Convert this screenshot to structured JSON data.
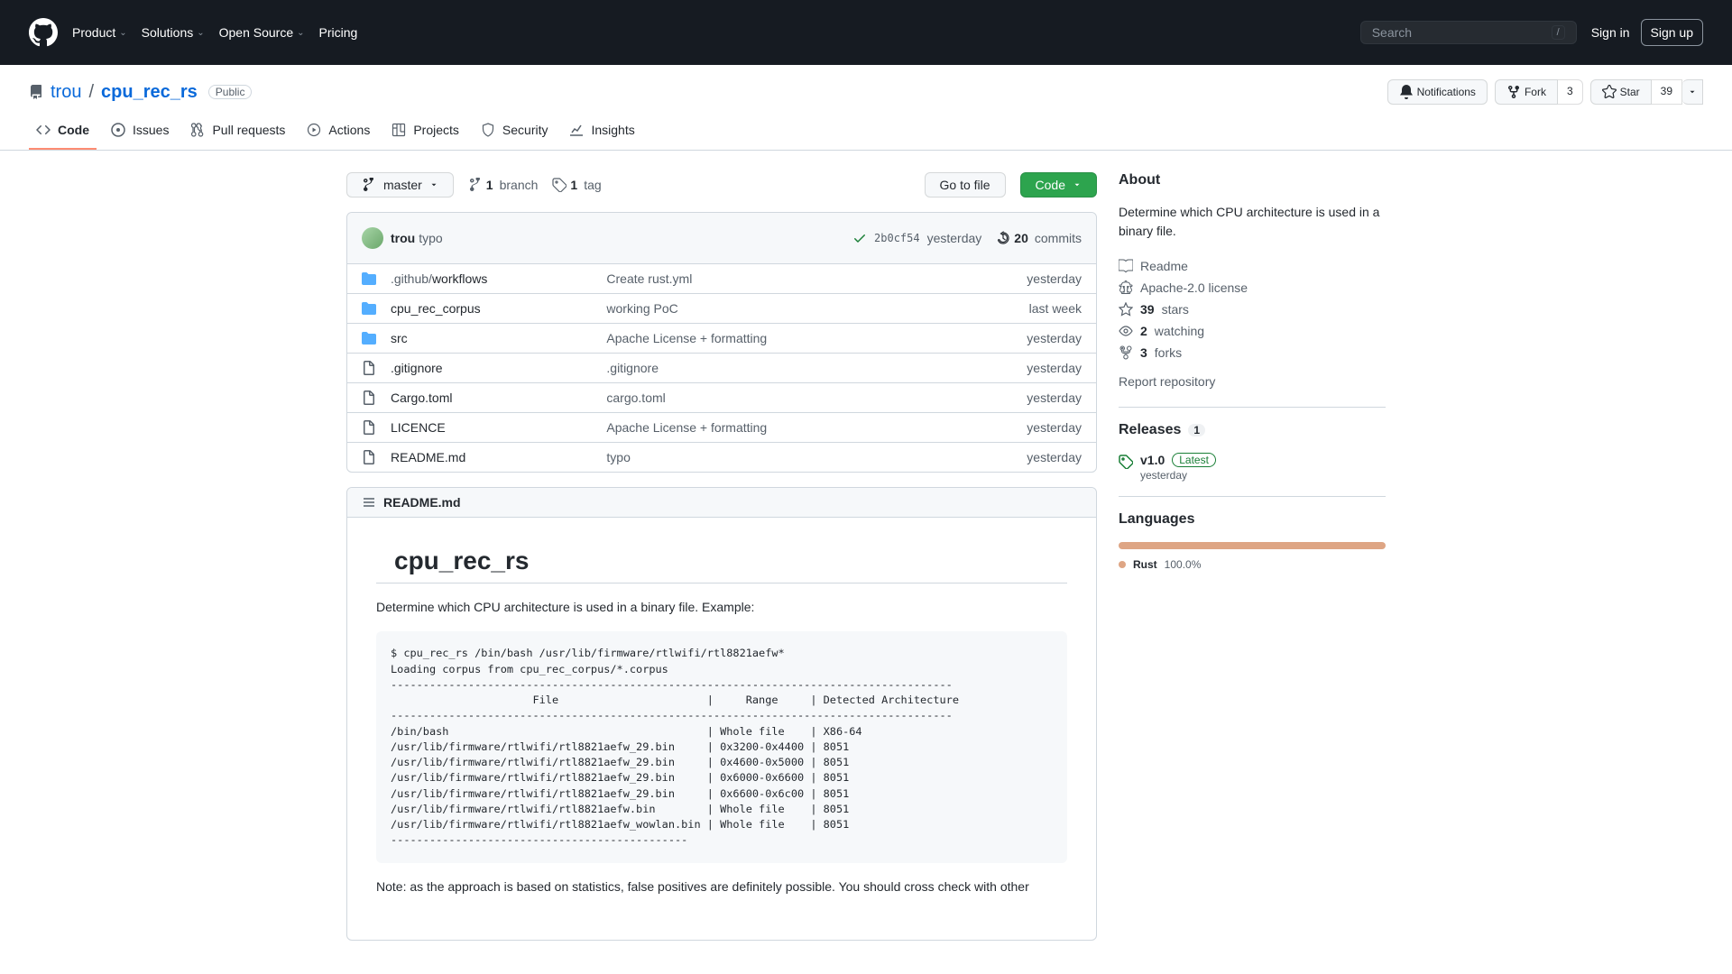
{
  "nav": {
    "links": [
      "Product",
      "Solutions",
      "Open Source",
      "Pricing"
    ],
    "search_placeholder": "Search",
    "slash": "/",
    "sign_in": "Sign in",
    "sign_up": "Sign up"
  },
  "repo": {
    "owner": "trou",
    "sep": "/",
    "name": "cpu_rec_rs",
    "visibility": "Public",
    "notifications": "Notifications",
    "fork": "Fork",
    "fork_count": "3",
    "star": "Star",
    "star_count": "39"
  },
  "tabs": [
    "Code",
    "Issues",
    "Pull requests",
    "Actions",
    "Projects",
    "Security",
    "Insights"
  ],
  "filetree": {
    "branch": "master",
    "branch_count": "1",
    "branch_label": "branch",
    "tag_count": "1",
    "tag_label": "tag",
    "goto": "Go to file",
    "code": "Code",
    "commit": {
      "author": "trou",
      "msg": "typo",
      "sha": "2b0cf54",
      "date": "yesterday",
      "count": "20",
      "count_label": "commits"
    },
    "rows": [
      {
        "type": "dir",
        "name": ".github/workflows",
        "prefix": ".github/",
        "base": "workflows",
        "msg": "Create rust.yml",
        "date": "yesterday"
      },
      {
        "type": "dir",
        "name": "cpu_rec_corpus",
        "prefix": "",
        "base": "cpu_rec_corpus",
        "msg": "working PoC",
        "date": "last week"
      },
      {
        "type": "dir",
        "name": "src",
        "prefix": "",
        "base": "src",
        "msg": "Apache License + formatting",
        "date": "yesterday"
      },
      {
        "type": "file",
        "name": ".gitignore",
        "prefix": "",
        "base": ".gitignore",
        "msg": ".gitignore",
        "date": "yesterday"
      },
      {
        "type": "file",
        "name": "Cargo.toml",
        "prefix": "",
        "base": "Cargo.toml",
        "msg": "cargo.toml",
        "date": "yesterday"
      },
      {
        "type": "file",
        "name": "LICENCE",
        "prefix": "",
        "base": "LICENCE",
        "msg": "Apache License + formatting",
        "date": "yesterday"
      },
      {
        "type": "file",
        "name": "README.md",
        "prefix": "",
        "base": "README.md",
        "msg": "typo",
        "date": "yesterday"
      }
    ]
  },
  "readme": {
    "filename": "README.md",
    "title": "cpu_rec_rs",
    "intro": "Determine which CPU architecture is used in a binary file. Example:",
    "code": "$ cpu_rec_rs /bin/bash /usr/lib/firmware/rtlwifi/rtl8821aefw*\nLoading corpus from cpu_rec_corpus/*.corpus\n---------------------------------------------------------------------------------------\n                      File                       |     Range     | Detected Architecture\n---------------------------------------------------------------------------------------\n/bin/bash                                        | Whole file    | X86-64\n/usr/lib/firmware/rtlwifi/rtl8821aefw_29.bin     | 0x3200-0x4400 | 8051\n/usr/lib/firmware/rtlwifi/rtl8821aefw_29.bin     | 0x4600-0x5000 | 8051\n/usr/lib/firmware/rtlwifi/rtl8821aefw_29.bin     | 0x6000-0x6600 | 8051\n/usr/lib/firmware/rtlwifi/rtl8821aefw_29.bin     | 0x6600-0x6c00 | 8051\n/usr/lib/firmware/rtlwifi/rtl8821aefw.bin        | Whole file    | 8051\n/usr/lib/firmware/rtlwifi/rtl8821aefw_wowlan.bin | Whole file    | 8051\n----------------------------------------------",
    "note": "Note: as the approach is based on statistics, false positives are definitely possible. You should cross check with other"
  },
  "sidebar": {
    "about_h": "About",
    "about_desc": "Determine which CPU architecture is used in a binary file.",
    "readme_link": "Readme",
    "license": "Apache-2.0 license",
    "stars_n": "39",
    "stars_l": "stars",
    "watch_n": "2",
    "watch_l": "watching",
    "forks_n": "3",
    "forks_l": "forks",
    "report": "Report repository",
    "releases_h": "Releases",
    "releases_count": "1",
    "release_ver": "v1.0",
    "release_latest": "Latest",
    "release_date": "yesterday",
    "lang_h": "Languages",
    "lang_name": "Rust",
    "lang_pct": "100.0%"
  }
}
